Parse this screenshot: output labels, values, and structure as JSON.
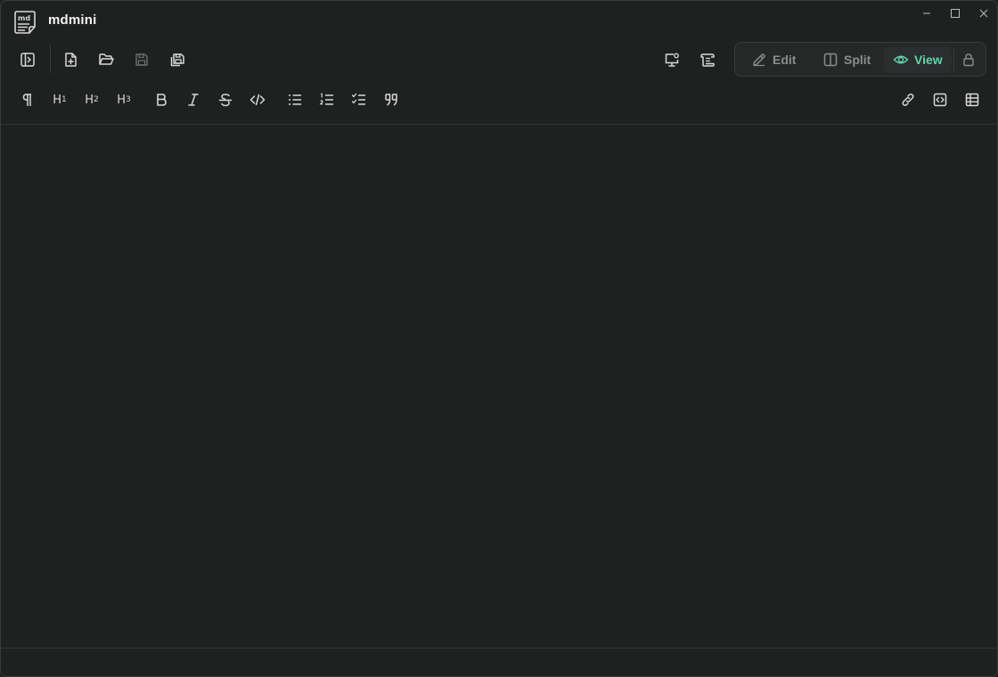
{
  "app": {
    "title": "mdmini"
  },
  "window_controls": {
    "minimize_icon": "minimize-icon",
    "maximize_icon": "maximize-icon",
    "close_icon": "close-icon"
  },
  "toolbar": {
    "left": [
      {
        "icon": "sidebar-toggle-icon"
      },
      {
        "icon": "new-file-icon"
      },
      {
        "icon": "open-folder-icon"
      },
      {
        "icon": "save-icon",
        "disabled": true
      },
      {
        "icon": "save-all-icon"
      }
    ],
    "right": [
      {
        "icon": "presentation-icon"
      },
      {
        "icon": "scroll-icon"
      }
    ]
  },
  "modes": {
    "edit_label": "Edit",
    "split_label": "Split",
    "view_label": "View",
    "active": "View",
    "lock_icon": "lock-icon"
  },
  "format_toolbar": {
    "items": [
      {
        "icon": "paragraph-icon"
      },
      {
        "label": "H",
        "sub": "1"
      },
      {
        "label": "H",
        "sub": "2"
      },
      {
        "label": "H",
        "sub": "3"
      },
      {
        "icon": "bold-icon"
      },
      {
        "icon": "italic-icon"
      },
      {
        "icon": "strikethrough-icon"
      },
      {
        "icon": "code-icon"
      },
      {
        "icon": "bullet-list-icon"
      },
      {
        "icon": "numbered-list-icon"
      },
      {
        "icon": "task-list-icon"
      },
      {
        "icon": "quote-icon"
      },
      {
        "icon": "link-icon"
      },
      {
        "icon": "code-block-icon"
      },
      {
        "icon": "table-icon"
      }
    ]
  },
  "colors": {
    "background": "#1f2121",
    "accent": "#5fd3ad",
    "icon": "#d8d8d8",
    "muted": "#8a8d8d"
  }
}
